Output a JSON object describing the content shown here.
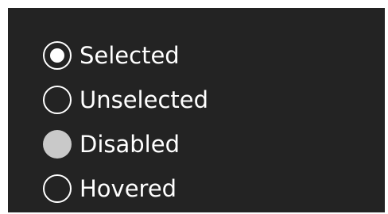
{
  "radio_group": {
    "options": [
      {
        "label": "Selected",
        "state": "selected"
      },
      {
        "label": "Unselected",
        "state": "unselected"
      },
      {
        "label": "Disabled",
        "state": "disabled"
      },
      {
        "label": "Hovered",
        "state": "hovered"
      }
    ]
  },
  "colors": {
    "panel_background": "#232323",
    "page_background": "#ffffff",
    "text": "#ffffff",
    "radio_border": "#ffffff",
    "disabled_fill": "#c9c9c9"
  }
}
